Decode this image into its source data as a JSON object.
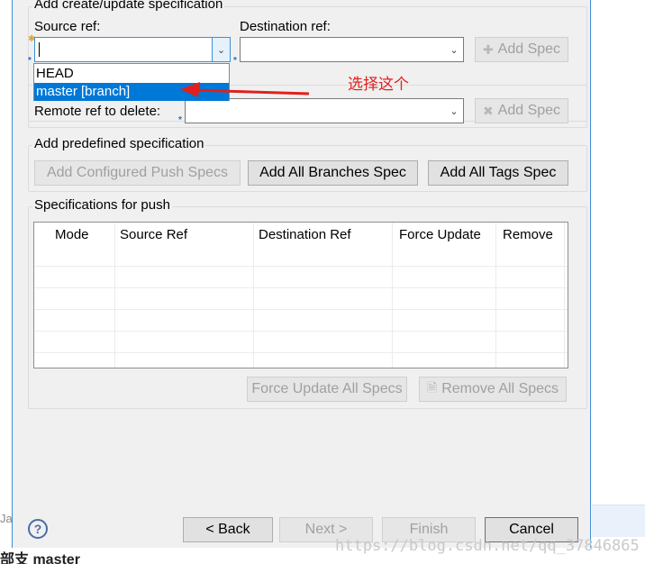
{
  "background": {
    "left_strip_text": "Jav",
    "bottom_text": "部支 master"
  },
  "create_update": {
    "title": "Add create/update specification",
    "source_label": "Source ref:",
    "destination_label": "Destination ref:",
    "source_value": "",
    "destination_value": "",
    "add_spec_label": "Add Spec",
    "dropdown_options": [
      "HEAD",
      "master [branch]"
    ],
    "selected_option": "master [branch]"
  },
  "annotation": {
    "text": "选择这个",
    "color": "#e0201c"
  },
  "delete": {
    "remote_label": "Remote ref to delete:",
    "remote_value": "",
    "add_spec_label": "Add Spec"
  },
  "predefined": {
    "title": "Add predefined specification",
    "configured_label": "Add Configured Push Specs",
    "branches_label": "Add All Branches Spec",
    "tags_label": "Add All Tags Spec"
  },
  "push_specs": {
    "title": "Specifications for push",
    "columns": [
      "Mode",
      "Source Ref",
      "Destination Ref",
      "Force Update",
      "Remove"
    ],
    "rows": [],
    "force_update_all_label": "Force Update All Specs",
    "remove_all_label": "Remove All Specs"
  },
  "footer": {
    "help_label": "?",
    "back_label": "< Back",
    "next_label": "Next >",
    "finish_label": "Finish",
    "cancel_label": "Cancel",
    "watermark": "https://blog.csdn.net/qq_37846865"
  },
  "colors": {
    "accent": "#0078d7",
    "dialog_bg": "#f0f0f0",
    "disabled_text": "#a0a0a0"
  }
}
